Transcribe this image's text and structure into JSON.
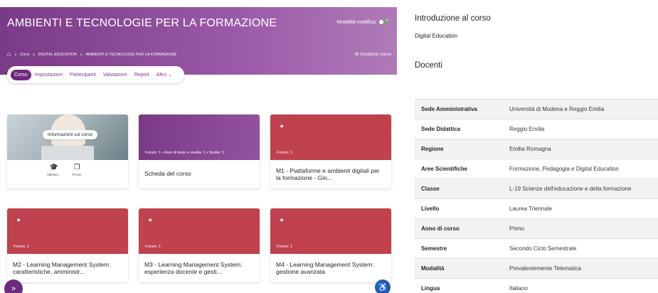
{
  "header": {
    "course_title": "AMBIENTI E TECNOLOGIE PER LA FORMAZIONE",
    "edit_mode_label": "Modalità modifica",
    "edit_mode_toggle_mark": "×",
    "home_icon": "home-icon",
    "breadcrumb": [
      "Corsi",
      "DIGITAL EDUCATION",
      "AMBIENTI E TECNOLOGIE PER LA FORMAZIONE"
    ],
    "breadcrumb_separator": "›",
    "course_management": "⚙ Gestione corso"
  },
  "tabs": [
    {
      "label": "Corso",
      "active": true
    },
    {
      "label": "Impostazioni"
    },
    {
      "label": "Partecipanti"
    },
    {
      "label": "Valutazioni"
    },
    {
      "label": "Report"
    },
    {
      "label": "Altro ⌄"
    }
  ],
  "cards": {
    "info": {
      "pill": "Informazioni sul corso",
      "icon_1_label": "Valutazi...",
      "icon_2_label": "Forum"
    },
    "scheda": {
      "meta": "Forum: 1  •  Aree di testo e media: 1  •  Scelte: 1",
      "title": "Scheda del corso"
    },
    "m1": {
      "meta": "Forum: 1",
      "title": "M1 - Piattaforme e ambienti digitali per la formazione - Gio..."
    },
    "m2": {
      "meta": "Forum: 1",
      "title": "M2 - Learning Management System: caratteristiche, amministr..."
    },
    "m3": {
      "meta": "Forum: 1",
      "title": "M3 - Learning Management System: esperienza docente e gesti..."
    },
    "m4": {
      "meta": "Forum: 1",
      "title": "M4 - Learning Management System: gestione avanzata"
    }
  },
  "fab_left": "»",
  "fab_right": "♿",
  "sidebar": {
    "intro_heading": "Introduzione al corso",
    "intro_text": "Digital Education",
    "teachers_heading": "Docenti",
    "details": [
      {
        "key": "Sede Amministrativa",
        "value": "Università di Modena e Reggio Emilia"
      },
      {
        "key": "Sede Didattica",
        "value": "Reggio Emilia"
      },
      {
        "key": "Regione",
        "value": "Emilia Romagna"
      },
      {
        "key": "Aree Scientifiche",
        "value": "Formazione, Pedagogia e Digital Education"
      },
      {
        "key": "Classe",
        "value": "L-19 Scienze dell'educazione e della formazione"
      },
      {
        "key": "Livello",
        "value": "Laurea Triennale"
      },
      {
        "key": "Anno di corso",
        "value": "Primo"
      },
      {
        "key": "Semestre",
        "value": "Secondo Ciclo Semestrale"
      },
      {
        "key": "Modalità",
        "value": "Prevalentemente Telematica"
      },
      {
        "key": "Lingua",
        "value": "Italiano"
      }
    ]
  },
  "colors": {
    "brand_purple": "#7a3a86",
    "module_red": "#c0424f",
    "accessibility_blue": "#1f5fa8"
  }
}
